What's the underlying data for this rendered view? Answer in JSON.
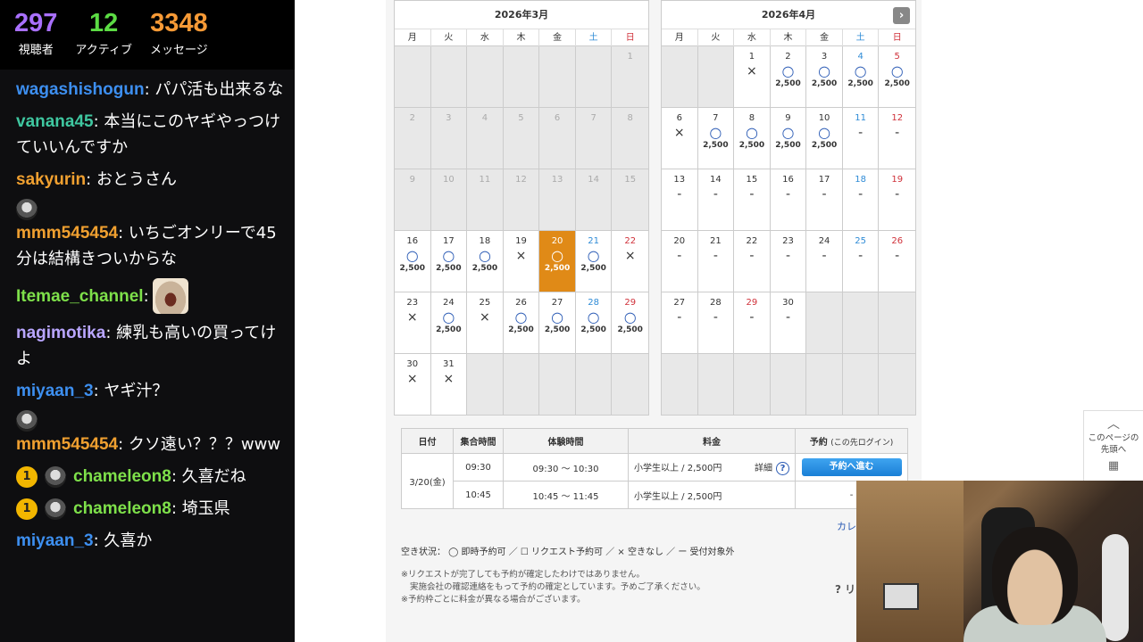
{
  "stats": [
    {
      "value": "297",
      "label": "視聴者",
      "color": "#a970ff"
    },
    {
      "value": "12",
      "label": "アクティブ",
      "color": "#5cdc44"
    },
    {
      "value": "3348",
      "label": "メッセージ",
      "color": "#f79a36"
    }
  ],
  "chat": [
    {
      "user": "wagashishogun",
      "color": "#3d8ff0",
      "text": ": パパ活も出来るな",
      "badge": "",
      "avatar": false,
      "emote": false
    },
    {
      "user": "vanana45",
      "color": "#3fc7a0",
      "text": ": 本当にこのヤギやっつけていいんですか",
      "badge": "",
      "avatar": false,
      "emote": false
    },
    {
      "user": "sakyurin",
      "color": "#f0a030",
      "text": ": おとうさん",
      "badge": "",
      "avatar": false,
      "emote": false
    },
    {
      "user": "mmm545454",
      "color": "#f0a030",
      "text": ": いちごオンリーで45分は結構きついからな",
      "badge": "",
      "avatar": true,
      "emote": false
    },
    {
      "user": "Itemae_channel",
      "color": "#7ee04a",
      "text": ":",
      "badge": "",
      "avatar": false,
      "emote": true
    },
    {
      "user": "nagimotika",
      "color": "#b9a6ff",
      "text": ": 練乳も高いの買ってけよ",
      "badge": "",
      "avatar": false,
      "emote": false
    },
    {
      "user": "miyaan_3",
      "color": "#3d8ff0",
      "text": ": ヤギ汁？",
      "badge": "",
      "avatar": false,
      "emote": false
    },
    {
      "user": "mmm545454",
      "color": "#f0a030",
      "text": ": クソ遠い？？？www",
      "badge": "",
      "avatar": true,
      "emote": false
    },
    {
      "user": "chameleon8",
      "color": "#7ee04a",
      "text": ": 久喜だね",
      "badge": "1",
      "avatar": true,
      "emote": false
    },
    {
      "user": "chameleon8",
      "color": "#7ee04a",
      "text": ": 埼玉県",
      "badge": "1",
      "avatar": true,
      "emote": false
    },
    {
      "user": "miyaan_3",
      "color": "#3d8ff0",
      "text": ": 久喜か",
      "badge": "",
      "avatar": false,
      "emote": false
    }
  ],
  "calendars": {
    "march": {
      "title": "2026年3月",
      "dow": [
        "月",
        "火",
        "水",
        "木",
        "金",
        "土",
        "日"
      ],
      "cells": [
        {
          "d": "",
          "t": "empty"
        },
        {
          "d": "",
          "t": "empty"
        },
        {
          "d": "",
          "t": "empty"
        },
        {
          "d": "",
          "t": "empty"
        },
        {
          "d": "",
          "t": "empty"
        },
        {
          "d": "",
          "t": "empty"
        },
        {
          "d": "1",
          "t": "off"
        },
        {
          "d": "2",
          "t": "off"
        },
        {
          "d": "3",
          "t": "off"
        },
        {
          "d": "4",
          "t": "off"
        },
        {
          "d": "5",
          "t": "off"
        },
        {
          "d": "6",
          "t": "off"
        },
        {
          "d": "7",
          "t": "off"
        },
        {
          "d": "8",
          "t": "off"
        },
        {
          "d": "9",
          "t": "off"
        },
        {
          "d": "10",
          "t": "off"
        },
        {
          "d": "11",
          "t": "off"
        },
        {
          "d": "12",
          "t": "off"
        },
        {
          "d": "13",
          "t": "off"
        },
        {
          "d": "14",
          "t": "off"
        },
        {
          "d": "15",
          "t": "off"
        },
        {
          "d": "16",
          "s": "○",
          "p": "2,500"
        },
        {
          "d": "17",
          "s": "○",
          "p": "2,500"
        },
        {
          "d": "18",
          "s": "○",
          "p": "2,500"
        },
        {
          "d": "19",
          "s": "×"
        },
        {
          "d": "20",
          "s": "○",
          "p": "2,500",
          "t": "sel"
        },
        {
          "d": "21",
          "s": "○",
          "p": "2,500",
          "w": "sat"
        },
        {
          "d": "22",
          "s": "×",
          "w": "sun"
        },
        {
          "d": "23",
          "s": "×"
        },
        {
          "d": "24",
          "s": "○",
          "p": "2,500"
        },
        {
          "d": "25",
          "s": "×"
        },
        {
          "d": "26",
          "s": "○",
          "p": "2,500"
        },
        {
          "d": "27",
          "s": "○",
          "p": "2,500"
        },
        {
          "d": "28",
          "s": "○",
          "p": "2,500",
          "w": "sat"
        },
        {
          "d": "29",
          "s": "○",
          "p": "2,500",
          "w": "sun"
        },
        {
          "d": "30",
          "s": "×"
        },
        {
          "d": "31",
          "s": "×"
        },
        {
          "d": "",
          "t": "empty"
        },
        {
          "d": "",
          "t": "empty"
        },
        {
          "d": "",
          "t": "empty"
        },
        {
          "d": "",
          "t": "empty"
        },
        {
          "d": "",
          "t": "empty"
        }
      ]
    },
    "april": {
      "title": "2026年4月",
      "next": "›",
      "dow": [
        "月",
        "火",
        "水",
        "木",
        "金",
        "土",
        "日"
      ],
      "cells": [
        {
          "d": "",
          "t": "empty"
        },
        {
          "d": "",
          "t": "empty"
        },
        {
          "d": "1",
          "s": "×"
        },
        {
          "d": "2",
          "s": "○",
          "p": "2,500"
        },
        {
          "d": "3",
          "s": "○",
          "p": "2,500"
        },
        {
          "d": "4",
          "s": "○",
          "p": "2,500",
          "w": "sat"
        },
        {
          "d": "5",
          "s": "○",
          "p": "2,500",
          "w": "sun"
        },
        {
          "d": "6",
          "s": "×"
        },
        {
          "d": "7",
          "s": "○",
          "p": "2,500"
        },
        {
          "d": "8",
          "s": "○",
          "p": "2,500"
        },
        {
          "d": "9",
          "s": "○",
          "p": "2,500"
        },
        {
          "d": "10",
          "s": "○",
          "p": "2,500"
        },
        {
          "d": "11",
          "s": "-",
          "w": "sat"
        },
        {
          "d": "12",
          "s": "-",
          "w": "sun"
        },
        {
          "d": "13",
          "s": "-"
        },
        {
          "d": "14",
          "s": "-"
        },
        {
          "d": "15",
          "s": "-"
        },
        {
          "d": "16",
          "s": "-"
        },
        {
          "d": "17",
          "s": "-"
        },
        {
          "d": "18",
          "s": "-",
          "w": "sat"
        },
        {
          "d": "19",
          "s": "-",
          "w": "sun"
        },
        {
          "d": "20",
          "s": "-"
        },
        {
          "d": "21",
          "s": "-"
        },
        {
          "d": "22",
          "s": "-"
        },
        {
          "d": "23",
          "s": "-"
        },
        {
          "d": "24",
          "s": "-"
        },
        {
          "d": "25",
          "s": "-",
          "w": "sat"
        },
        {
          "d": "26",
          "s": "-",
          "w": "sun"
        },
        {
          "d": "27",
          "s": "-"
        },
        {
          "d": "28",
          "s": "-"
        },
        {
          "d": "29",
          "s": "-",
          "w": "sun"
        },
        {
          "d": "30",
          "s": "-"
        },
        {
          "d": "",
          "t": "empty"
        },
        {
          "d": "",
          "t": "empty"
        },
        {
          "d": "",
          "t": "empty"
        },
        {
          "d": "",
          "t": "empty"
        },
        {
          "d": "",
          "t": "empty"
        },
        {
          "d": "",
          "t": "empty"
        },
        {
          "d": "",
          "t": "empty"
        },
        {
          "d": "",
          "t": "empty"
        },
        {
          "d": "",
          "t": "empty"
        },
        {
          "d": "",
          "t": "empty"
        }
      ]
    }
  },
  "table": {
    "headers": {
      "date": "日付",
      "meet": "集合時間",
      "exp": "体験時間",
      "fee": "料金",
      "book": "予約",
      "book_sub": "(この先ログイン)"
    },
    "date": "3/20(金)",
    "rows": [
      {
        "meet": "09:30",
        "exp": "09:30 ～ 10:30",
        "fee": "小学生以上 / 2,500円",
        "detail": "詳細",
        "btn": "予約へ進む"
      },
      {
        "meet": "10:45",
        "exp": "10:45 ～ 11:45",
        "fee": "小学生以上 / 2,500円",
        "detail": "",
        "btn": "-"
      }
    ]
  },
  "legend": "空き状況： ◯ 即時予約可 ／ ☐ リクエスト予約可 ／ × 空きなし ／ ー 受付対象外",
  "notes": {
    "n1": "※リクエストが完了しても予約が確定したわけではありません。",
    "n2": "実施会社の確認連絡をもって予約の確定としています。予めご了承ください。",
    "n3": "※予約枠ごとに料金が異なる場合がございます。"
  },
  "cal_link": "カレ",
  "help_link": "? リ",
  "side_tool": {
    "line1": "このページの",
    "line2": "先頭へ"
  }
}
